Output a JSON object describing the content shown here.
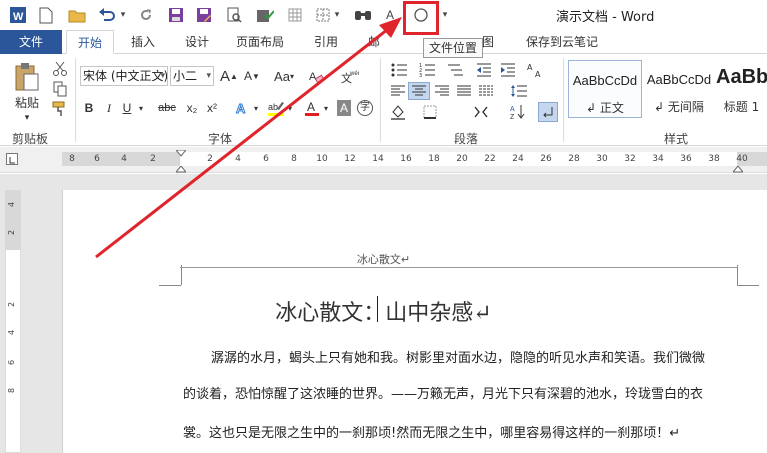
{
  "window": {
    "title": "演示文档 - Word"
  },
  "quick_access": {
    "icons": [
      "word-icon",
      "new-icon",
      "open-icon",
      "undo-icon",
      "redo-icon",
      "save-icon",
      "save-as-icon",
      "print-preview-icon",
      "spell-check-icon",
      "table-icon",
      "border-icon",
      "find-icon",
      "font-size-icon",
      "file-location-icon",
      "customize-icon"
    ]
  },
  "tooltip": {
    "text": "文件位置"
  },
  "tabs": [
    {
      "label": "文件",
      "active": false
    },
    {
      "label": "开始",
      "active": true
    },
    {
      "label": "插入",
      "active": false
    },
    {
      "label": "设计",
      "active": false
    },
    {
      "label": "页面布局",
      "active": false
    },
    {
      "label": "引用",
      "active": false
    },
    {
      "label": "邮",
      "active": false
    },
    {
      "label": "图",
      "active": false
    },
    {
      "label": "保存到云笔记",
      "active": false
    }
  ],
  "ribbon": {
    "clipboard": {
      "label": "剪贴板",
      "paste_label": "粘贴"
    },
    "font": {
      "label": "字体",
      "font_name": "宋体 (中文正文)",
      "font_size": "小二",
      "bold": "B",
      "italic": "I",
      "underline": "U",
      "strike": "abc",
      "sub": "x₂",
      "sup": "x²",
      "grow": "A",
      "shrink": "A",
      "case": "Aa",
      "char_shade": "A",
      "char_border": "字"
    },
    "paragraph": {
      "label": "段落"
    },
    "styles": {
      "label": "样式",
      "items": [
        {
          "sample": "AaBbCcDd",
          "name": "正文",
          "selected": true
        },
        {
          "sample": "AaBbCcDd",
          "name": "无间隔",
          "selected": false
        },
        {
          "sample": "AaBb",
          "name": "标题 1",
          "selected": false
        }
      ]
    }
  },
  "ruler": {
    "ticks": [
      "8",
      "6",
      "4",
      "2",
      "2",
      "4",
      "6",
      "8",
      "10",
      "12",
      "14",
      "16",
      "18",
      "20",
      "22",
      "24",
      "26",
      "28",
      "30",
      "32",
      "34",
      "36",
      "38",
      "40"
    ],
    "vertical_ticks": [
      "4",
      "2",
      "2",
      "4",
      "6",
      "8"
    ]
  },
  "document": {
    "header": "冰心散文↵",
    "title": "冰心散文：山中杂感↵",
    "paragraphs": [
      "潺潺的水月，蝎头上只有她和我。树影里对面水边，隐隐的听见水声和笑语。我们微微",
      "的谈着，恐怕惊醒了这浓睡的世界。——万籁无声，月光下只有深碧的池水，玲珑雪白的衣",
      "裳。这也只是无限之生中的一刹那顷!然而无限之生中，哪里容易得这样的一刹那顷！↵"
    ]
  },
  "colors": {
    "brand": "#2b579a",
    "annotation": "#e0242b"
  }
}
